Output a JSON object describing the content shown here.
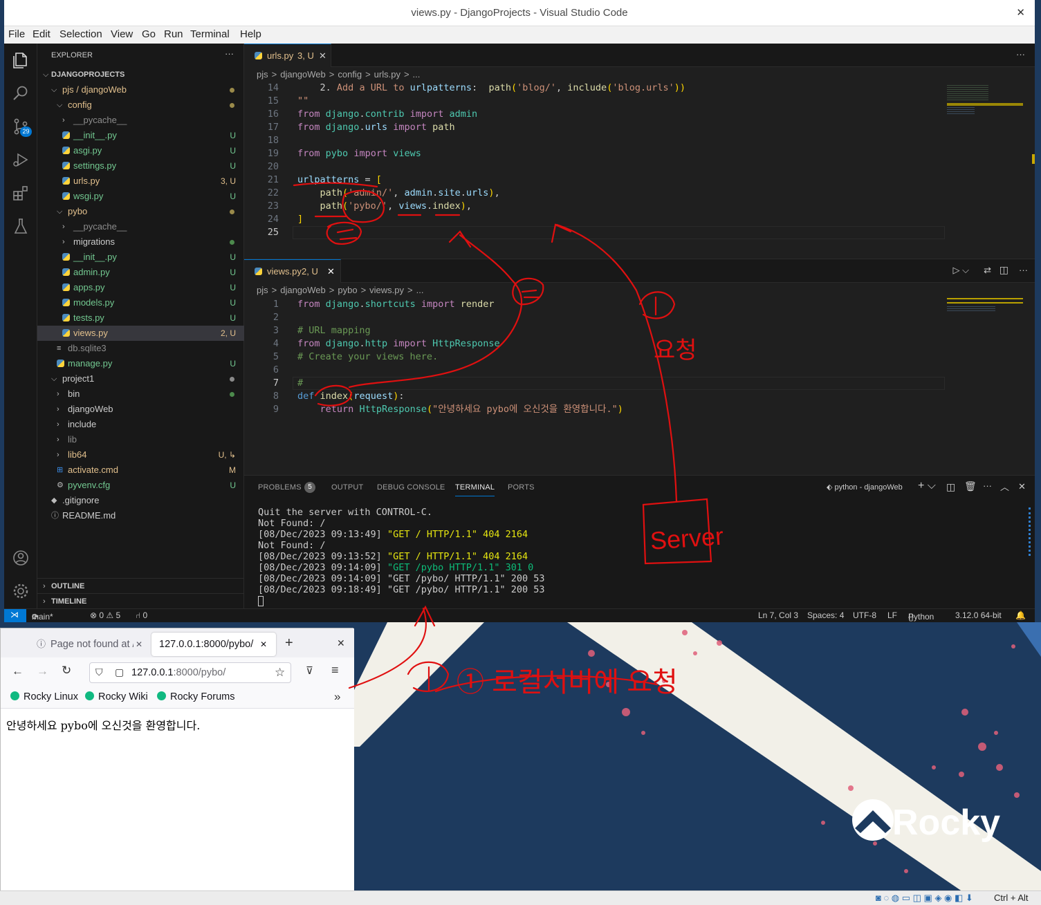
{
  "window": {
    "title": "views.py - DjangoProjects - Visual Studio Code",
    "close": "✕"
  },
  "menu": [
    "File",
    "Edit",
    "Selection",
    "View",
    "Go",
    "Run",
    "Terminal",
    "Help"
  ],
  "activity": {
    "scm_badge": "29"
  },
  "explorer": {
    "header": "EXPLORER",
    "more": "···",
    "root": "DJANGOPROJECTS",
    "tree": [
      {
        "label": "pjs / djangoWeb",
        "status": "",
        "dot": "#9a8a4a"
      },
      {
        "label": "config",
        "status": "",
        "dot": "#9a8a4a"
      },
      {
        "label": "__pycache__",
        "status": ""
      },
      {
        "label": "__init__.py",
        "status": "U"
      },
      {
        "label": "asgi.py",
        "status": "U"
      },
      {
        "label": "settings.py",
        "status": "U"
      },
      {
        "label": "urls.py",
        "status": "3, U"
      },
      {
        "label": "wsgi.py",
        "status": "U"
      },
      {
        "label": "pybo",
        "status": "",
        "dot": "#9a8a4a"
      },
      {
        "label": "__pycache__",
        "status": ""
      },
      {
        "label": "migrations",
        "status": "",
        "dot": "#4c8a4c"
      },
      {
        "label": "__init__.py",
        "status": "U"
      },
      {
        "label": "admin.py",
        "status": "U"
      },
      {
        "label": "apps.py",
        "status": "U"
      },
      {
        "label": "models.py",
        "status": "U"
      },
      {
        "label": "tests.py",
        "status": "U"
      },
      {
        "label": "views.py",
        "status": "2, U"
      },
      {
        "label": "db.sqlite3",
        "status": ""
      },
      {
        "label": "manage.py",
        "status": "U"
      },
      {
        "label": "project1",
        "status": "",
        "dot": "#8a8a8a"
      },
      {
        "label": "bin",
        "status": "",
        "dot": "#4c8a4c"
      },
      {
        "label": "djangoWeb",
        "status": ""
      },
      {
        "label": "include",
        "status": ""
      },
      {
        "label": "lib",
        "status": ""
      },
      {
        "label": "lib64",
        "status": "U, ↳"
      },
      {
        "label": "activate.cmd",
        "status": "M"
      },
      {
        "label": "pyvenv.cfg",
        "status": "U"
      },
      {
        "label": ".gitignore",
        "status": ""
      },
      {
        "label": "README.md",
        "status": ""
      }
    ],
    "outline": "OUTLINE",
    "timeline": "TIMELINE"
  },
  "editor_top": {
    "tab": "urls.py",
    "tab_status": "3, U",
    "breadcrumb": [
      "pjs",
      ">",
      "djangoWeb",
      ">",
      "config",
      ">",
      "urls.py",
      ">",
      "..."
    ],
    "lines": [
      {
        "n": "14",
        "t": "    2. Add a URL to urlpatterns:  path('blog/', include('blog.urls'))"
      },
      {
        "n": "15",
        "t": "\"\"\""
      },
      {
        "n": "16",
        "t": "from django.contrib import admin"
      },
      {
        "n": "17",
        "t": "from django.urls import path"
      },
      {
        "n": "18",
        "t": ""
      },
      {
        "n": "19",
        "t": "from pybo import views"
      },
      {
        "n": "20",
        "t": ""
      },
      {
        "n": "21",
        "t": "urlpatterns = ["
      },
      {
        "n": "22",
        "t": "    path('admin/', admin.site.urls),"
      },
      {
        "n": "23",
        "t": "    path('pybo/', views.index),"
      },
      {
        "n": "24",
        "t": "]"
      },
      {
        "n": "25",
        "t": ""
      }
    ]
  },
  "editor_bot": {
    "tab": "views.py",
    "tab_status": "2, U",
    "breadcrumb": [
      "pjs",
      ">",
      "djangoWeb",
      ">",
      "pybo",
      ">",
      "views.py",
      ">",
      "..."
    ],
    "lines": [
      {
        "n": "1",
        "t": "from django.shortcuts import render"
      },
      {
        "n": "2",
        "t": ""
      },
      {
        "n": "3",
        "t": "# URL mapping"
      },
      {
        "n": "4",
        "t": "from django.http import HttpResponse"
      },
      {
        "n": "5",
        "t": "# Create your views here."
      },
      {
        "n": "6",
        "t": ""
      },
      {
        "n": "7",
        "t": "#"
      },
      {
        "n": "8",
        "t": "def index(request):"
      },
      {
        "n": "9",
        "t": "    return HttpResponse(\"안녕하세요 pybo에 오신것을 환영합니다.\")"
      }
    ]
  },
  "panel": {
    "tabs": [
      "PROBLEMS",
      "OUTPUT",
      "DEBUG CONSOLE",
      "TERMINAL",
      "PORTS"
    ],
    "problems_count": "5",
    "terminal_name": "python - djangoWeb",
    "terminal_lines": [
      "Quit the server with CONTROL-C.",
      "Not Found: /",
      "[08/Dec/2023 09:13:49] \"GET / HTTP/1.1\" 404 2164",
      "Not Found: /",
      "[08/Dec/2023 09:13:52] \"GET / HTTP/1.1\" 404 2164",
      "[08/Dec/2023 09:14:09] \"GET /pybo HTTP/1.1\" 301 0",
      "[08/Dec/2023 09:14:09] \"GET /pybo/ HTTP/1.1\" 200 53",
      "[08/Dec/2023 09:18:49] \"GET /pybo/ HTTP/1.1\" 200 53"
    ]
  },
  "status": {
    "branch": "main*",
    "errors": "⊗ 0 ⚠ 5",
    "ports": "⑁ 0",
    "position": "Ln 7, Col 3",
    "spaces": "Spaces: 4",
    "encoding": "UTF-8",
    "eol": "LF",
    "language": "Python",
    "interpreter": "3.12.0 64-bit"
  },
  "browser": {
    "tab1": "Page not found at /",
    "tab2": "127.0.0.1:8000/pybo/",
    "url_host": "127.0.0.1",
    "url_rest": ":8000/pybo/",
    "bookmarks": [
      "Rocky Linux",
      "Rocky Wiki",
      "Rocky Forums"
    ],
    "content": "안녕하세요 pybo에 오신것을 환영합니다."
  },
  "desktop": {
    "brand": "Rocky"
  },
  "annotations": {
    "a1": "① 로컬서버에 요청",
    "a2": "①",
    "a3": "요청",
    "a4": "Server",
    "a5": "②",
    "a6": "②"
  },
  "tray": {
    "keys": "Ctrl + Alt"
  }
}
